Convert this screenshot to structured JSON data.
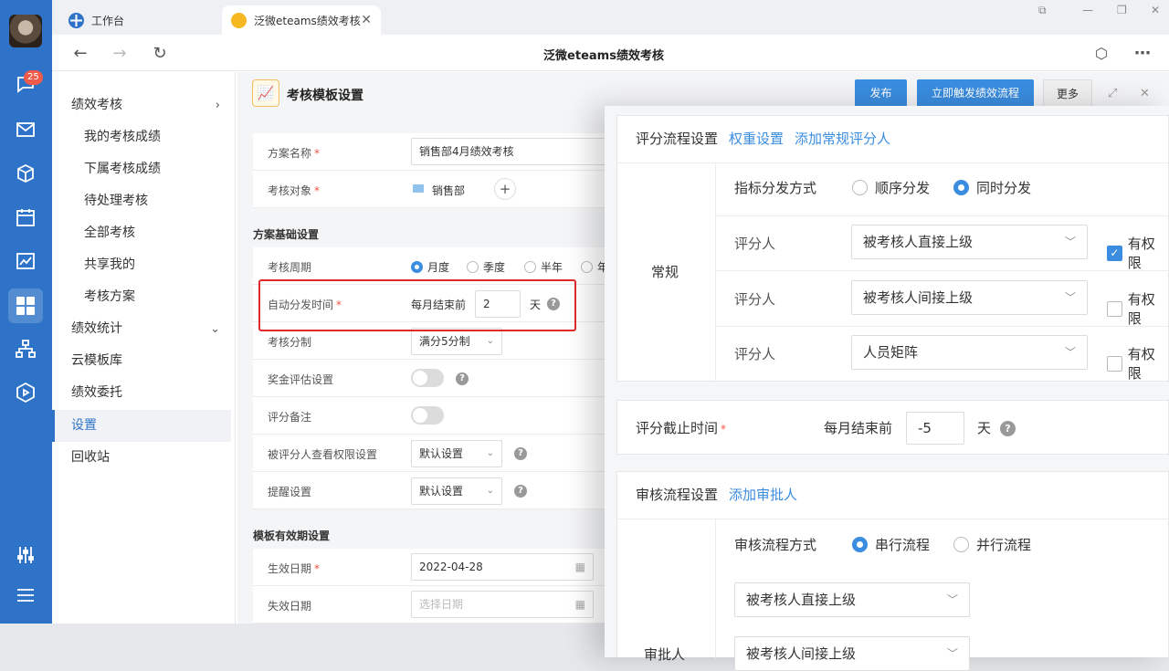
{
  "rail": {
    "badge": "25"
  },
  "tabs": [
    {
      "label": "工作台"
    },
    {
      "label": "泛微eteams绩效考核"
    }
  ],
  "nav": {
    "title": "泛微eteams绩效考核"
  },
  "menu": {
    "items": [
      {
        "label": "绩效考核",
        "arrow": "›"
      },
      {
        "label": "我的考核成绩"
      },
      {
        "label": "下属考核成绩"
      },
      {
        "label": "待处理考核"
      },
      {
        "label": "全部考核"
      },
      {
        "label": "共享我的"
      },
      {
        "label": "考核方案"
      },
      {
        "label": "绩效统计",
        "arrow": "⌄"
      },
      {
        "label": "云模板库"
      },
      {
        "label": "绩效委托"
      },
      {
        "label": "设置"
      },
      {
        "label": "回收站"
      }
    ]
  },
  "header": {
    "title": "考核模板设置",
    "publish_label": "发布",
    "trigger_label": "立即触发绩效流程",
    "more_label": "更多"
  },
  "form": {
    "plan_name_label": "方案名称",
    "plan_name_value": "销售部4月绩效考核",
    "target_label": "考核对象",
    "target_value": "销售部",
    "basic_section": "方案基础设置",
    "cycle_label": "考核周期",
    "cycle_options": [
      "月度",
      "季度",
      "半年",
      "年"
    ],
    "auto_label": "自动分发时间",
    "auto_prefix": "每月结束前",
    "auto_value": "2",
    "auto_unit": "天",
    "score_label": "考核分制",
    "score_value": "满分5分制",
    "bonus_label": "奖金评估设置",
    "remark_label": "评分备注",
    "perm_label": "被评分人查看权限设置",
    "perm_value": "默认设置",
    "remind_label": "提醒设置",
    "remind_value": "默认设置",
    "valid_section": "模板有效期设置",
    "start_label": "生效日期",
    "start_value": "2022-04-28",
    "end_label": "失效日期",
    "end_placeholder": "选择日期"
  },
  "panel": {
    "flow_title": "评分流程设置",
    "weight_link": "权重设置",
    "add_scorer_link": "添加常规评分人",
    "normal_label": "常规",
    "dispatch_label": "指标分发方式",
    "dispatch_options": [
      "顺序分发",
      "同时分发"
    ],
    "scorers": [
      {
        "label": "评分人",
        "value": "被考核人直接上级",
        "perm": "有权限",
        "checked": true
      },
      {
        "label": "评分人",
        "value": "被考核人间接上级",
        "perm": "有权限",
        "checked": false
      },
      {
        "label": "评分人",
        "value": "人员矩阵",
        "perm": "有权限",
        "checked": false
      }
    ],
    "deadline_label": "评分截止时间",
    "deadline_prefix": "每月结束前",
    "deadline_value": "-5",
    "deadline_unit": "天",
    "review_title": "审核流程设置",
    "add_approver_link": "添加审批人",
    "review_mode_label": "审核流程方式",
    "review_options": [
      "串行流程",
      "并行流程"
    ],
    "approver_label": "审批人",
    "approvers": [
      "被考核人直接上级",
      "被考核人间接上级"
    ]
  },
  "colors": {
    "rail": "#2f73c9",
    "primary": "#3a8de0",
    "highlight": "#e02a2a"
  }
}
